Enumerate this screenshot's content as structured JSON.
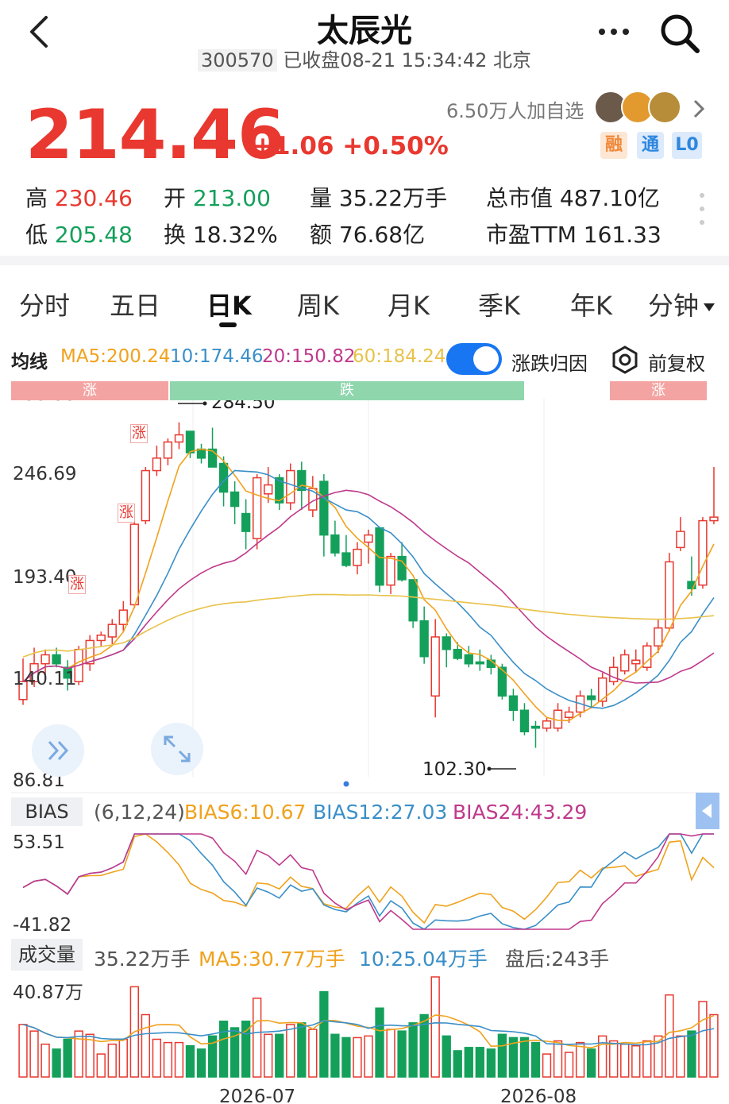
{
  "header": {
    "title": "太辰光",
    "code": "300570",
    "status": "已收盘08-21 15:34:42 北京"
  },
  "quote": {
    "price": "214.46",
    "change": "+1.06 +0.50%",
    "watchers": "6.50万人加自选",
    "badges": [
      "融",
      "通",
      "L0"
    ],
    "stats": {
      "high_label": "高",
      "high": "230.46",
      "low_label": "低",
      "low": "205.48",
      "open_label": "开",
      "open": "213.00",
      "turnover_label": "换",
      "turnover": "18.32%",
      "volume_label": "量",
      "volume": "35.22万手",
      "amount_label": "额",
      "amount": "76.68亿",
      "mcap_label": "总市值",
      "mcap": "487.10亿",
      "pe_label": "市盈TTM",
      "pe": "161.33"
    }
  },
  "tabs": [
    "分时",
    "五日",
    "日K",
    "周K",
    "月K",
    "季K",
    "年K",
    "分钟"
  ],
  "active_tab": "日K",
  "ma_row": {
    "label": "均线",
    "ma5": "MA5:200.24",
    "ma10": "10:174.46",
    "ma20": "20:150.82",
    "ma60": "60:184.24",
    "toggle_label": "涨跌归因",
    "adjust_label": "前复权"
  },
  "colors": {
    "up": "#e8382f",
    "down": "#14a05b",
    "ma5": "#f0a21d",
    "ma10": "#3a8fc8",
    "ma20": "#c0398c",
    "ma60": "#e8c24a",
    "accent": "#1976f2"
  },
  "chart_data": [
    {
      "type": "candlestick",
      "y_ticks": [
        "299.99",
        "246.69",
        "193.40",
        "140.11",
        "86.81"
      ],
      "ylim": [
        86.81,
        299.99
      ],
      "bands": [
        {
          "label": "涨",
          "color": "#ef9a9a"
        },
        {
          "label": "跌",
          "color": "#8fd6ad"
        },
        {
          "label": "涨",
          "color": "#ef9a9a"
        }
      ],
      "annotations": {
        "max": "284.50",
        "min": "102.30"
      },
      "tags": [
        "涨",
        "涨",
        "涨"
      ],
      "x_ticks": [
        "2026-07",
        "2026-08"
      ],
      "candles": [
        [
          130,
          153,
          127,
          140
        ],
        [
          140,
          159,
          137,
          150
        ],
        [
          150,
          158,
          144,
          155
        ],
        [
          155,
          159,
          148,
          150
        ],
        [
          148,
          152,
          135,
          142
        ],
        [
          140,
          160,
          138,
          158
        ],
        [
          150,
          166,
          146,
          163
        ],
        [
          163,
          168,
          160,
          166
        ],
        [
          165,
          175,
          161,
          172
        ],
        [
          172,
          185,
          168,
          180
        ],
        [
          183,
          230,
          181,
          228
        ],
        [
          230,
          260,
          228,
          258
        ],
        [
          258,
          272,
          255,
          265
        ],
        [
          265,
          276,
          261,
          274
        ],
        [
          274,
          285,
          270,
          278
        ],
        [
          280,
          278,
          265,
          268
        ],
        [
          270,
          273,
          262,
          265
        ],
        [
          270,
          282,
          263,
          260
        ],
        [
          262,
          266,
          238,
          246
        ],
        [
          246,
          252,
          228,
          238
        ],
        [
          234,
          242,
          214,
          224
        ],
        [
          220,
          256,
          214,
          254
        ],
        [
          245,
          260,
          240,
          250
        ],
        [
          254,
          256,
          236,
          240
        ],
        [
          240,
          262,
          236,
          258
        ],
        [
          258,
          263,
          236,
          247
        ],
        [
          236,
          255,
          232,
          248
        ],
        [
          252,
          256,
          210,
          222
        ],
        [
          222,
          230,
          210,
          212
        ],
        [
          212,
          222,
          204,
          205
        ],
        [
          205,
          218,
          200,
          214
        ],
        [
          218,
          225,
          206,
          222
        ],
        [
          226,
          226,
          190,
          194
        ],
        [
          194,
          212,
          189,
          210
        ],
        [
          210,
          218,
          196,
          197
        ],
        [
          197,
          197,
          170,
          174
        ],
        [
          174,
          182,
          150,
          154
        ],
        [
          132,
          175,
          120,
          165
        ],
        [
          165,
          167,
          148,
          158
        ],
        [
          158,
          162,
          152,
          153
        ],
        [
          155,
          160,
          148,
          150
        ],
        [
          151,
          158,
          146,
          150
        ],
        [
          152,
          155,
          144,
          148
        ],
        [
          148,
          150,
          130,
          132
        ],
        [
          132,
          136,
          118,
          124
        ],
        [
          124,
          128,
          110,
          112
        ],
        [
          115,
          118,
          103,
          114
        ],
        [
          114,
          120,
          112,
          118
        ],
        [
          114,
          128,
          112,
          124
        ],
        [
          120,
          126,
          117,
          123
        ],
        [
          123,
          135,
          120,
          132
        ],
        [
          132,
          136,
          125,
          130
        ],
        [
          129,
          145,
          126,
          142
        ],
        [
          140,
          154,
          138,
          148
        ],
        [
          146,
          158,
          144,
          155
        ],
        [
          150,
          158,
          145,
          152
        ],
        [
          148,
          162,
          146,
          160
        ],
        [
          160,
          175,
          156,
          170
        ],
        [
          170,
          212,
          168,
          207
        ],
        [
          215,
          232,
          213,
          224
        ],
        [
          196,
          210,
          188,
          192
        ],
        [
          194,
          232,
          192,
          230
        ],
        [
          230,
          260,
          228,
          232
        ]
      ]
    },
    {
      "type": "line",
      "name": "BIAS",
      "params": "(6,12,24)",
      "ytick_top": "53.51",
      "ytick_bottom": "-41.82",
      "series_labels": [
        "BIAS6:10.67",
        "BIAS12:27.03",
        "BIAS24:43.29"
      ]
    },
    {
      "type": "bar",
      "name": "成交量",
      "volume": "35.22万手",
      "ma5": "MA5:30.77万手",
      "ma10": "10:25.04万手",
      "after_hours": "盘后:243手",
      "ytick_top": "40.87万"
    }
  ]
}
